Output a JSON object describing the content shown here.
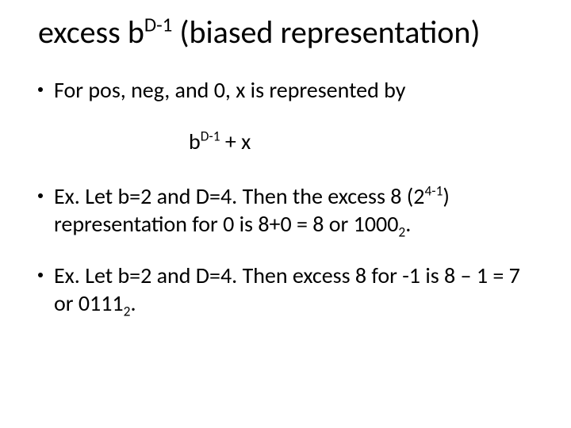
{
  "title": {
    "pre": "excess b",
    "exp": "D-1",
    "post": " (biased representation)"
  },
  "bullet1": "For pos, neg, and 0, x is represented by",
  "formula": {
    "pre": "b",
    "exp": "D-1",
    "post": " + x"
  },
  "bullet2": {
    "a": "Ex. Let b=2 and D=4.  Then the excess 8 (2",
    "exp": "4-1",
    "b": ") representation for 0 is 8+0 = 8 or 1000",
    "sub": "2",
    "c": "."
  },
  "bullet3": {
    "a": "Ex. Let b=2 and D=4.  Then excess 8 for -1 is 8 – 1 = 7 or 0111",
    "sub": "2",
    "b": "."
  }
}
